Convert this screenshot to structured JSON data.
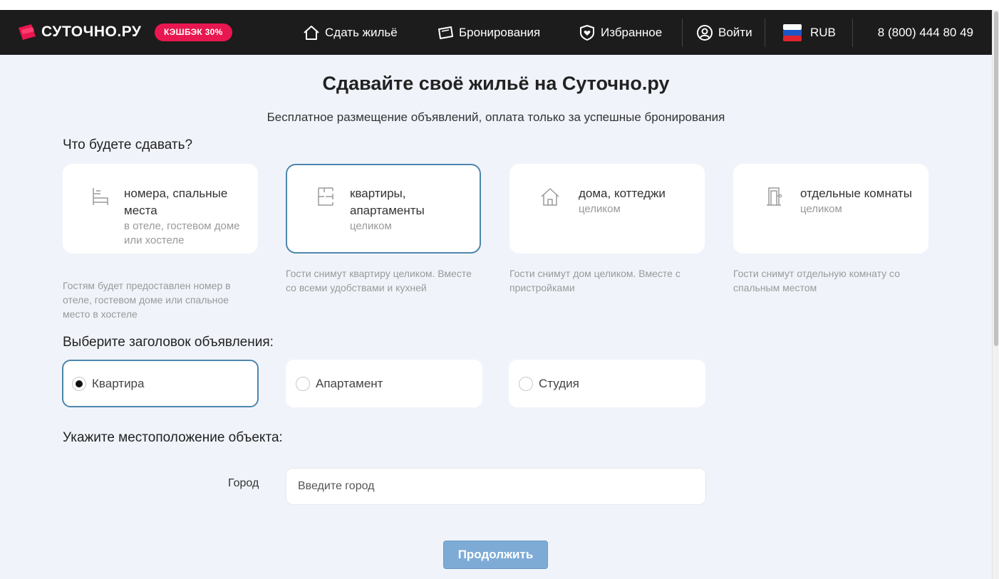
{
  "header": {
    "logo_text": "СУТОЧНО.РУ",
    "cashback_badge": "КЭШБЭК 30%",
    "nav": {
      "rent_out": "Сдать жильё",
      "bookings": "Бронирования",
      "favorites": "Избранное",
      "login": "Войти",
      "currency": "RUB"
    },
    "phone": "8 (800) 444 80 49"
  },
  "page": {
    "title": "Сдавайте своё жильё на Суточно.ру",
    "subtitle": "Бесплатное размещение объявлений, оплата только за успешные бронирования"
  },
  "property_type": {
    "label": "Что будете сдавать?",
    "options": [
      {
        "title": "номера, спальные места",
        "sub": "в отеле, гостевом доме или хостеле",
        "desc": "Гостям будет предоставлен номер в отеле, гостевом доме или спальное место в хостеле",
        "icon": "bed-icon",
        "selected": false
      },
      {
        "title": "квартиры, апартаменты",
        "sub": "целиком",
        "desc": "Гости снимут квартиру целиком. Вместе со всеми удобствами и кухней",
        "icon": "floorplan-icon",
        "selected": true
      },
      {
        "title": "дома, коттеджи",
        "sub": "целиком",
        "desc": "Гости снимут дом целиком. Вместе с пристройками",
        "icon": "house-icon",
        "selected": false
      },
      {
        "title": "отдельные комнаты",
        "sub": "целиком",
        "desc": "Гости снимут отдельную комнату со спальным местом",
        "icon": "door-icon",
        "selected": false
      }
    ]
  },
  "listing_title": {
    "label": "Выберите заголовок объявления:",
    "options": [
      {
        "label": "Квартира",
        "checked": true
      },
      {
        "label": "Апартамент",
        "checked": false
      },
      {
        "label": "Студия",
        "checked": false
      }
    ]
  },
  "location": {
    "label": "Укажите местоположение объекта:",
    "city_label": "Город",
    "city_value": "",
    "city_placeholder": "Введите город"
  },
  "continue_label": "Продолжить",
  "colors": {
    "header_bg": "#1c1c1c",
    "badge": "#e8174f",
    "selected_border": "#4d86ad",
    "button": "#7eabd6",
    "page_bg": "#f0f4fa"
  }
}
